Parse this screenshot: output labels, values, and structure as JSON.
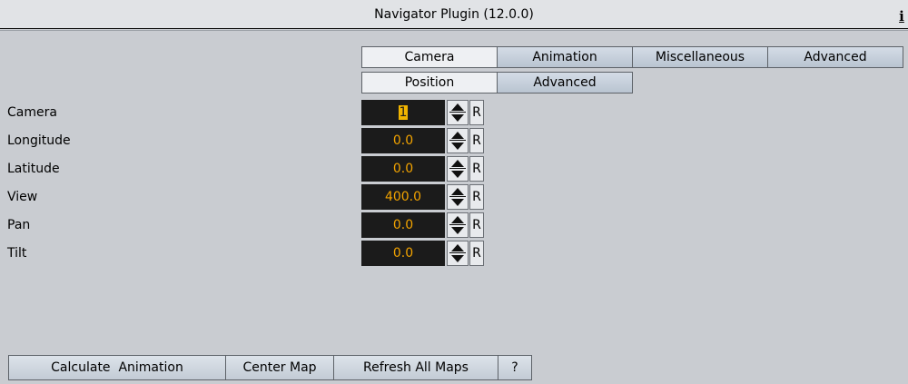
{
  "window": {
    "title": "Navigator Plugin (12.0.0)",
    "info_icon": "info-icon",
    "info_glyph": "i"
  },
  "tabs": [
    {
      "label": "Camera",
      "active": true
    },
    {
      "label": "Animation",
      "active": false
    },
    {
      "label": "Miscellaneous",
      "active": false
    },
    {
      "label": "Advanced",
      "active": false
    }
  ],
  "subtabs": [
    {
      "label": "Position",
      "active": true
    },
    {
      "label": "Advanced",
      "active": false
    }
  ],
  "parameters": [
    {
      "label": "Camera",
      "value": "1"
    },
    {
      "label": "Longitude",
      "value": "0.0"
    },
    {
      "label": "Latitude",
      "value": "0.0"
    },
    {
      "label": "View",
      "value": "400.0"
    },
    {
      "label": "Pan",
      "value": "0.0"
    },
    {
      "label": "Tilt",
      "value": "0.0"
    }
  ],
  "reset_label": "R",
  "bottom_buttons": [
    {
      "label": "Calculate  Animation"
    },
    {
      "label": "Center Map"
    },
    {
      "label": "Refresh All Maps"
    },
    {
      "label": "?"
    }
  ],
  "colors": {
    "field_bg": "#1b1b1b",
    "field_text": "#f2a300",
    "panel_bg": "#c9ccd1"
  }
}
